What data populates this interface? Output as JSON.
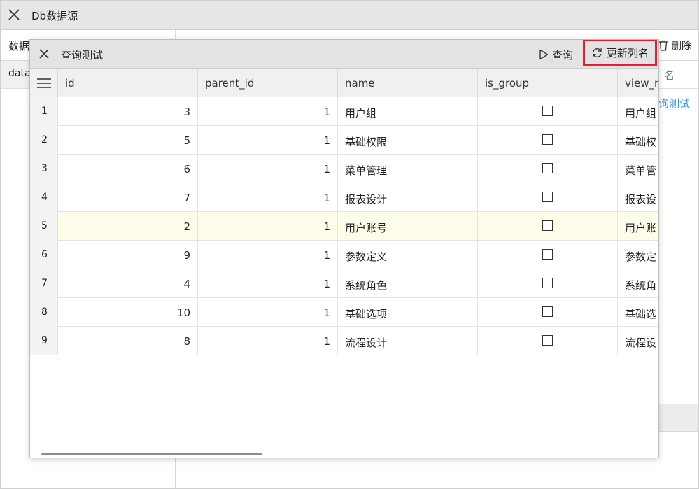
{
  "outer": {
    "title": "Db数据源",
    "left_tab": "数据",
    "left_row": "data",
    "delete_label": "删除",
    "right_header": "名",
    "right_row_link": "询测试"
  },
  "dialog": {
    "title": "查询测试",
    "query_label": "查询",
    "refresh_label": "更新列名"
  },
  "grid": {
    "columns": [
      "id",
      "parent_id",
      "name",
      "is_group",
      "view_n"
    ],
    "rows": [
      {
        "num": "1",
        "id": "3",
        "parent_id": "1",
        "name": "用户组",
        "is_group": false,
        "view_name": "用户组"
      },
      {
        "num": "2",
        "id": "5",
        "parent_id": "1",
        "name": "基础权限",
        "is_group": false,
        "view_name": "基础权"
      },
      {
        "num": "3",
        "id": "6",
        "parent_id": "1",
        "name": "菜单管理",
        "is_group": false,
        "view_name": "菜单管"
      },
      {
        "num": "4",
        "id": "7",
        "parent_id": "1",
        "name": "报表设计",
        "is_group": false,
        "view_name": "报表设"
      },
      {
        "num": "5",
        "id": "2",
        "parent_id": "1",
        "name": "用户账号",
        "is_group": false,
        "view_name": "用户账"
      },
      {
        "num": "6",
        "id": "9",
        "parent_id": "1",
        "name": "参数定义",
        "is_group": false,
        "view_name": "参数定"
      },
      {
        "num": "7",
        "id": "4",
        "parent_id": "1",
        "name": "系统角色",
        "is_group": false,
        "view_name": "系统角"
      },
      {
        "num": "8",
        "id": "10",
        "parent_id": "1",
        "name": "基础选项",
        "is_group": false,
        "view_name": "基础选"
      },
      {
        "num": "9",
        "id": "8",
        "parent_id": "1",
        "name": "流程设计",
        "is_group": false,
        "view_name": "流程设"
      }
    ],
    "selected_row": 4
  },
  "colors": {
    "highlight_border": "#e0202a",
    "selected_row_bg": "#fdfdea",
    "link": "#2a8fd6"
  }
}
